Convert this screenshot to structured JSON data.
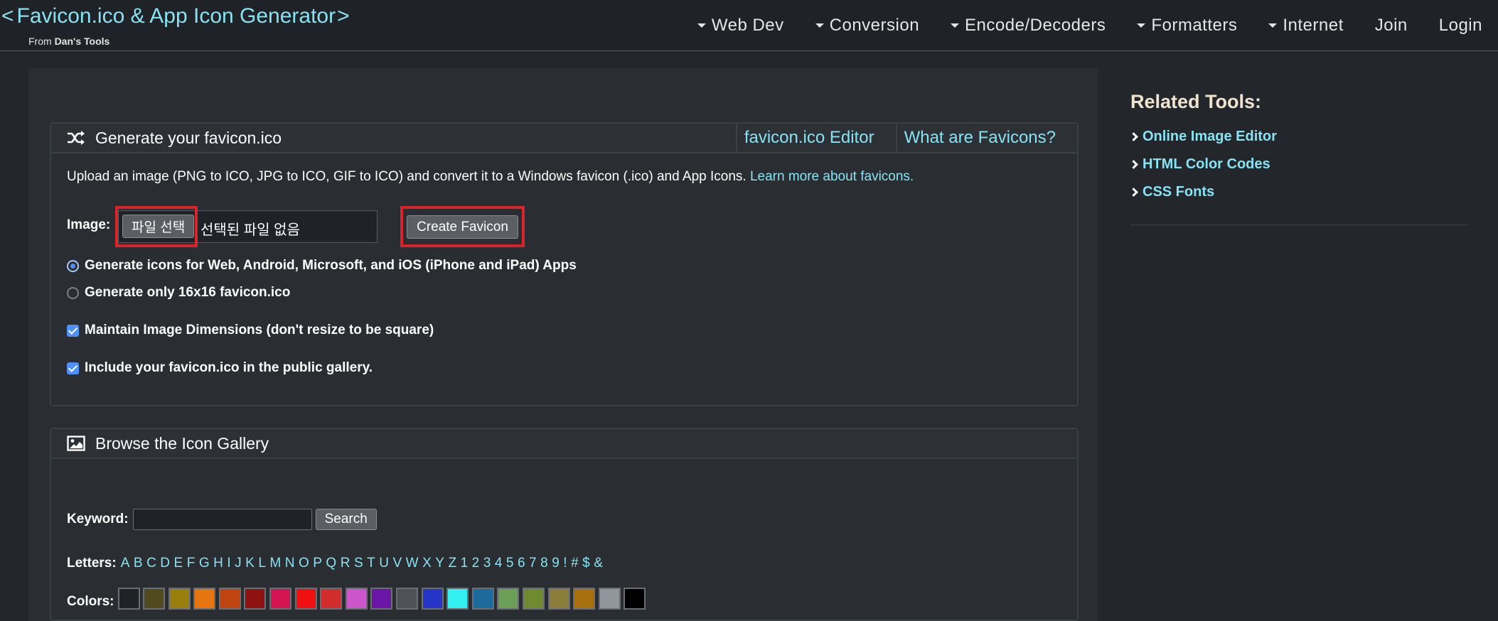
{
  "header": {
    "title": "Favicon.ico & App Icon Generator",
    "chevron_left": "<",
    "chevron_right": ">",
    "from_prefix": "From",
    "from_brand": "Dan's Tools",
    "nav": [
      {
        "label": "Web Dev",
        "dropdown": true
      },
      {
        "label": "Conversion",
        "dropdown": true
      },
      {
        "label": "Encode/Decoders",
        "dropdown": true
      },
      {
        "label": "Formatters",
        "dropdown": true
      },
      {
        "label": "Internet",
        "dropdown": true
      },
      {
        "label": "Join",
        "dropdown": false
      },
      {
        "label": "Login",
        "dropdown": false
      }
    ]
  },
  "generate": {
    "title": "Generate your favicon.ico",
    "icon": "shuffle-icon",
    "link_editor": "favicon.ico Editor",
    "link_about": "What are Favicons?",
    "intro_text": "Upload an image (PNG to ICO, JPG to ICO, GIF to ICO) and convert it to a Windows favicon (.ico) and App Icons.",
    "intro_link": "Learn more about favicons.",
    "image_label": "Image:",
    "file_button": "파일 선택",
    "file_name": "선택된 파일 없음",
    "create_button": "Create Favicon",
    "option_all": "Generate icons for Web, Android, Microsoft, and iOS (iPhone and iPad) Apps",
    "option_16": "Generate only 16x16 favicon.ico",
    "option_all_selected": true,
    "check_maintain": "Maintain Image Dimensions (don't resize to be square)",
    "check_maintain_checked": true,
    "check_gallery": "Include your favicon.ico in the public gallery.",
    "check_gallery_checked": true
  },
  "gallery": {
    "title": "Browse the Icon Gallery",
    "icon": "image-icon",
    "keyword_label": "Keyword:",
    "keyword_value": "",
    "search_button": "Search",
    "letters_label": "Letters:",
    "letters": [
      "A",
      "B",
      "C",
      "D",
      "E",
      "F",
      "G",
      "H",
      "I",
      "J",
      "K",
      "L",
      "M",
      "N",
      "O",
      "P",
      "Q",
      "R",
      "S",
      "T",
      "U",
      "V",
      "W",
      "X",
      "Y",
      "Z",
      "1",
      "2",
      "3",
      "4",
      "5",
      "6",
      "7",
      "8",
      "9",
      "!",
      "#",
      "$",
      "&"
    ],
    "colors_label": "Colors:",
    "colors": [
      "#202325",
      "#524a1f",
      "#9a7e0e",
      "#e67411",
      "#c0440f",
      "#8f1110",
      "#d41452",
      "#f01010",
      "#d22d2d",
      "#cc55cc",
      "#6b14a8",
      "#4e5156",
      "#2435c8",
      "#33f0f0",
      "#1d6b9c",
      "#6b9e57",
      "#6f8a2f",
      "#8b7d3a",
      "#a8700f",
      "#8f969c",
      "#000000"
    ]
  },
  "sidebar": {
    "title": "Related Tools:",
    "items": [
      "Online Image Editor",
      "HTML Color Codes",
      "CSS Fonts"
    ]
  }
}
